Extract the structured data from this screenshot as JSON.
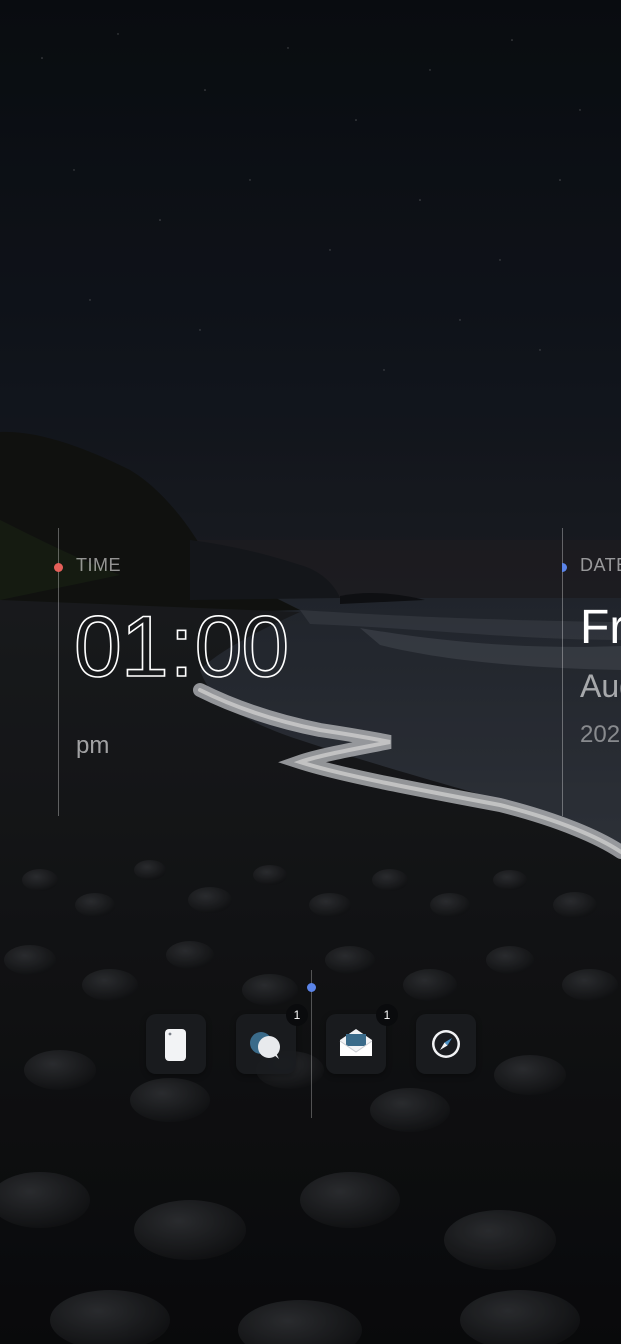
{
  "time": {
    "label": "TIME",
    "hours": "01",
    "separator": ":",
    "minutes": "00",
    "period": "pm",
    "accent": "#e5605a"
  },
  "date": {
    "label": "DATE",
    "day": "Fri",
    "month": "Aug",
    "year": "202",
    "accent": "#5b84e8"
  },
  "dock": {
    "accent": "#5b84e8",
    "apps": [
      {
        "name": "phone",
        "icon": "phone-icon",
        "badge": ""
      },
      {
        "name": "messages",
        "icon": "chat-bubbles-icon",
        "badge": "1"
      },
      {
        "name": "mail",
        "icon": "mail-envelope-icon",
        "badge": "1"
      },
      {
        "name": "browser",
        "icon": "compass-icon",
        "badge": ""
      }
    ]
  }
}
